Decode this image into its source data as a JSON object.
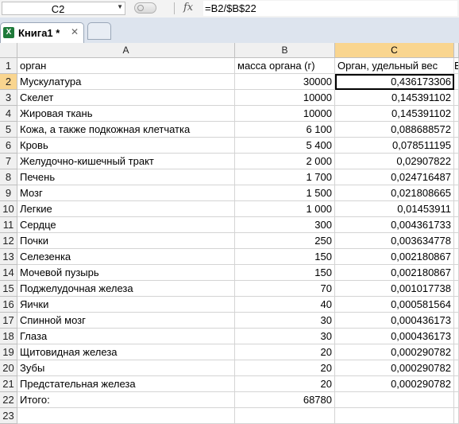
{
  "formula_bar": {
    "name_box": "C2",
    "fx_label": "fx",
    "formula": "=B2/$B$22"
  },
  "tab": {
    "icon_letter": "X",
    "title": "Книга1 *",
    "close": "✕"
  },
  "columns": [
    "A",
    "B",
    "C"
  ],
  "rows": [
    {
      "n": "1",
      "a": "орган",
      "b": "масса органа (г)",
      "c": "Орган, удельный вес",
      "d": "В"
    },
    {
      "n": "2",
      "a": "Мускулатура",
      "b": "30000",
      "c": "0,436173306"
    },
    {
      "n": "3",
      "a": "Скелет",
      "b": "10000",
      "c": "0,145391102"
    },
    {
      "n": "4",
      "a": "Жировая ткань",
      "b": "10000",
      "c": "0,145391102"
    },
    {
      "n": "5",
      "a": "Кожа, а также подкожная клетчатка",
      "b": "6 100",
      "c": "0,088688572"
    },
    {
      "n": "6",
      "a": "Кровь",
      "b": "5 400",
      "c": "0,078511195"
    },
    {
      "n": "7",
      "a": "Желудочно-кишечный тракт",
      "b": "2 000",
      "c": "0,02907822"
    },
    {
      "n": "8",
      "a": "Печень",
      "b": "1 700",
      "c": "0,024716487"
    },
    {
      "n": "9",
      "a": "Мозг",
      "b": "1 500",
      "c": "0,021808665"
    },
    {
      "n": "10",
      "a": "Легкие",
      "b": "1 000",
      "c": "0,01453911"
    },
    {
      "n": "11",
      "a": "Сердце",
      "b": "300",
      "c": "0,004361733"
    },
    {
      "n": "12",
      "a": "Почки",
      "b": "250",
      "c": "0,003634778"
    },
    {
      "n": "13",
      "a": "Селезенка",
      "b": "150",
      "c": "0,002180867"
    },
    {
      "n": "14",
      "a": "Мочевой пузырь",
      "b": "150",
      "c": "0,002180867"
    },
    {
      "n": "15",
      "a": "Поджелудочная железа",
      "b": "70",
      "c": "0,001017738"
    },
    {
      "n": "16",
      "a": "Яички",
      "b": "40",
      "c": "0,000581564"
    },
    {
      "n": "17",
      "a": "Спинной мозг",
      "b": "30",
      "c": "0,000436173"
    },
    {
      "n": "18",
      "a": "Глаза",
      "b": "30",
      "c": "0,000436173"
    },
    {
      "n": "19",
      "a": "Щитовидная железа",
      "b": "20",
      "c": "0,000290782"
    },
    {
      "n": "20",
      "a": "Зубы",
      "b": "20",
      "c": "0,000290782"
    },
    {
      "n": "21",
      "a": "Предстательная железа",
      "b": "20",
      "c": "0,000290782"
    },
    {
      "n": "22",
      "a": "Итого:",
      "b": "68780",
      "c": ""
    },
    {
      "n": "23",
      "a": "",
      "b": "",
      "c": ""
    }
  ],
  "selection": {
    "cell": "C2",
    "column": "C",
    "row": "2"
  },
  "colors": {
    "selected_header": "#f9d58f",
    "tab_strip": "#dde4ee",
    "excel_green": "#1f7a3a"
  }
}
